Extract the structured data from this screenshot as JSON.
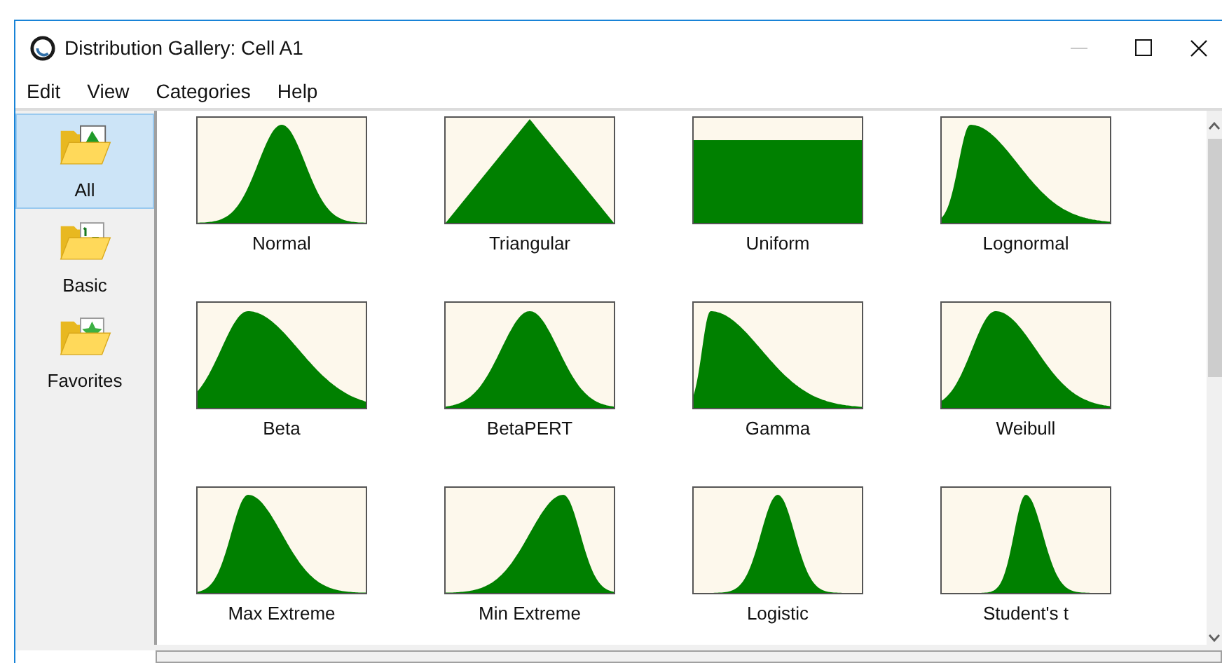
{
  "window": {
    "title": "Distribution Gallery: Cell A1"
  },
  "menu": [
    "Edit",
    "View",
    "Categories",
    "Help"
  ],
  "sidebar": {
    "items": [
      {
        "label": "All",
        "kind": "chart",
        "selected": true
      },
      {
        "label": "Basic",
        "kind": "numbers",
        "selected": false
      },
      {
        "label": "Favorites",
        "kind": "star",
        "selected": false
      }
    ]
  },
  "gallery": {
    "items": [
      {
        "label": "Normal",
        "kind": "normal"
      },
      {
        "label": "Triangular",
        "kind": "triangular"
      },
      {
        "label": "Uniform",
        "kind": "uniform"
      },
      {
        "label": "Lognormal",
        "kind": "lognormal"
      },
      {
        "label": "Beta",
        "kind": "beta"
      },
      {
        "label": "BetaPERT",
        "kind": "betapert"
      },
      {
        "label": "Gamma",
        "kind": "gamma"
      },
      {
        "label": "Weibull",
        "kind": "weibull"
      },
      {
        "label": "Max Extreme",
        "kind": "maxextreme"
      },
      {
        "label": "Min Extreme",
        "kind": "minextreme"
      },
      {
        "label": "Logistic",
        "kind": "logistic"
      },
      {
        "label": "Student's t",
        "kind": "studentt"
      }
    ]
  }
}
